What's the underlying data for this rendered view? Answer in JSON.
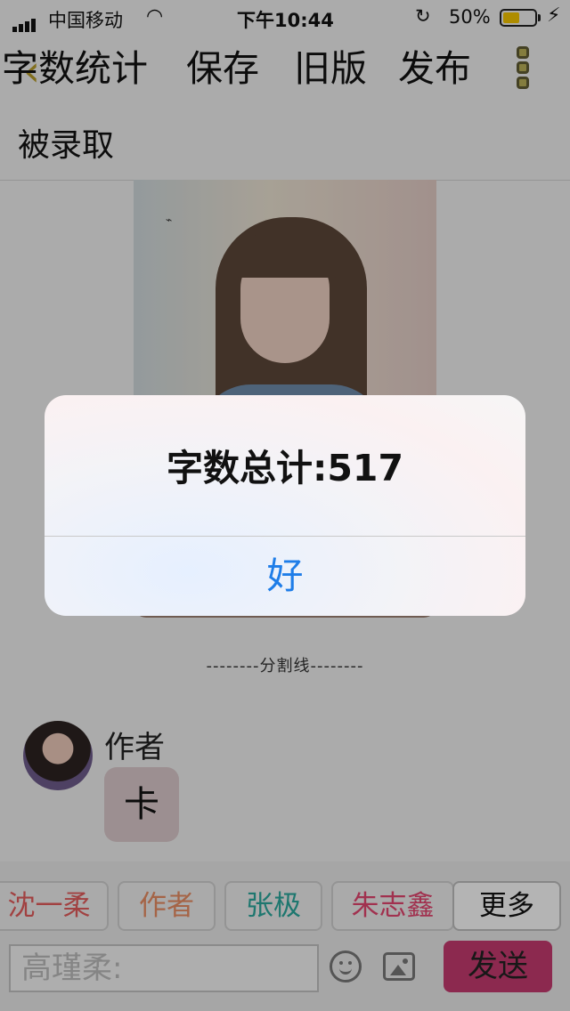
{
  "status_bar": {
    "carrier": "中国移动",
    "time": "下午10:44",
    "battery": "50%"
  },
  "toolbar": {
    "word_count": "字数统计",
    "save": "保存",
    "old_version": "旧版",
    "publish": "发布"
  },
  "story": {
    "title": "被录取",
    "divider": "--------分割线--------"
  },
  "chat": {
    "author_name": "作者",
    "message": "卡"
  },
  "characters": [
    {
      "label": "沈一柔",
      "color": "#e05a5a"
    },
    {
      "label": "作者",
      "color": "#e58b62"
    },
    {
      "label": "张极",
      "color": "#2aa59a"
    },
    {
      "label": "朱志鑫",
      "color": "#e0456e"
    },
    {
      "label": "更多",
      "color": "#111111"
    }
  ],
  "composer": {
    "placeholder": "高瑾柔:",
    "send": "发送"
  },
  "alert": {
    "message": "字数总计:517",
    "ok": "好"
  },
  "colors": {
    "accent_blue": "#1e7de8",
    "send_button": "#c23a6e",
    "battery_fill": "#f2c200"
  }
}
